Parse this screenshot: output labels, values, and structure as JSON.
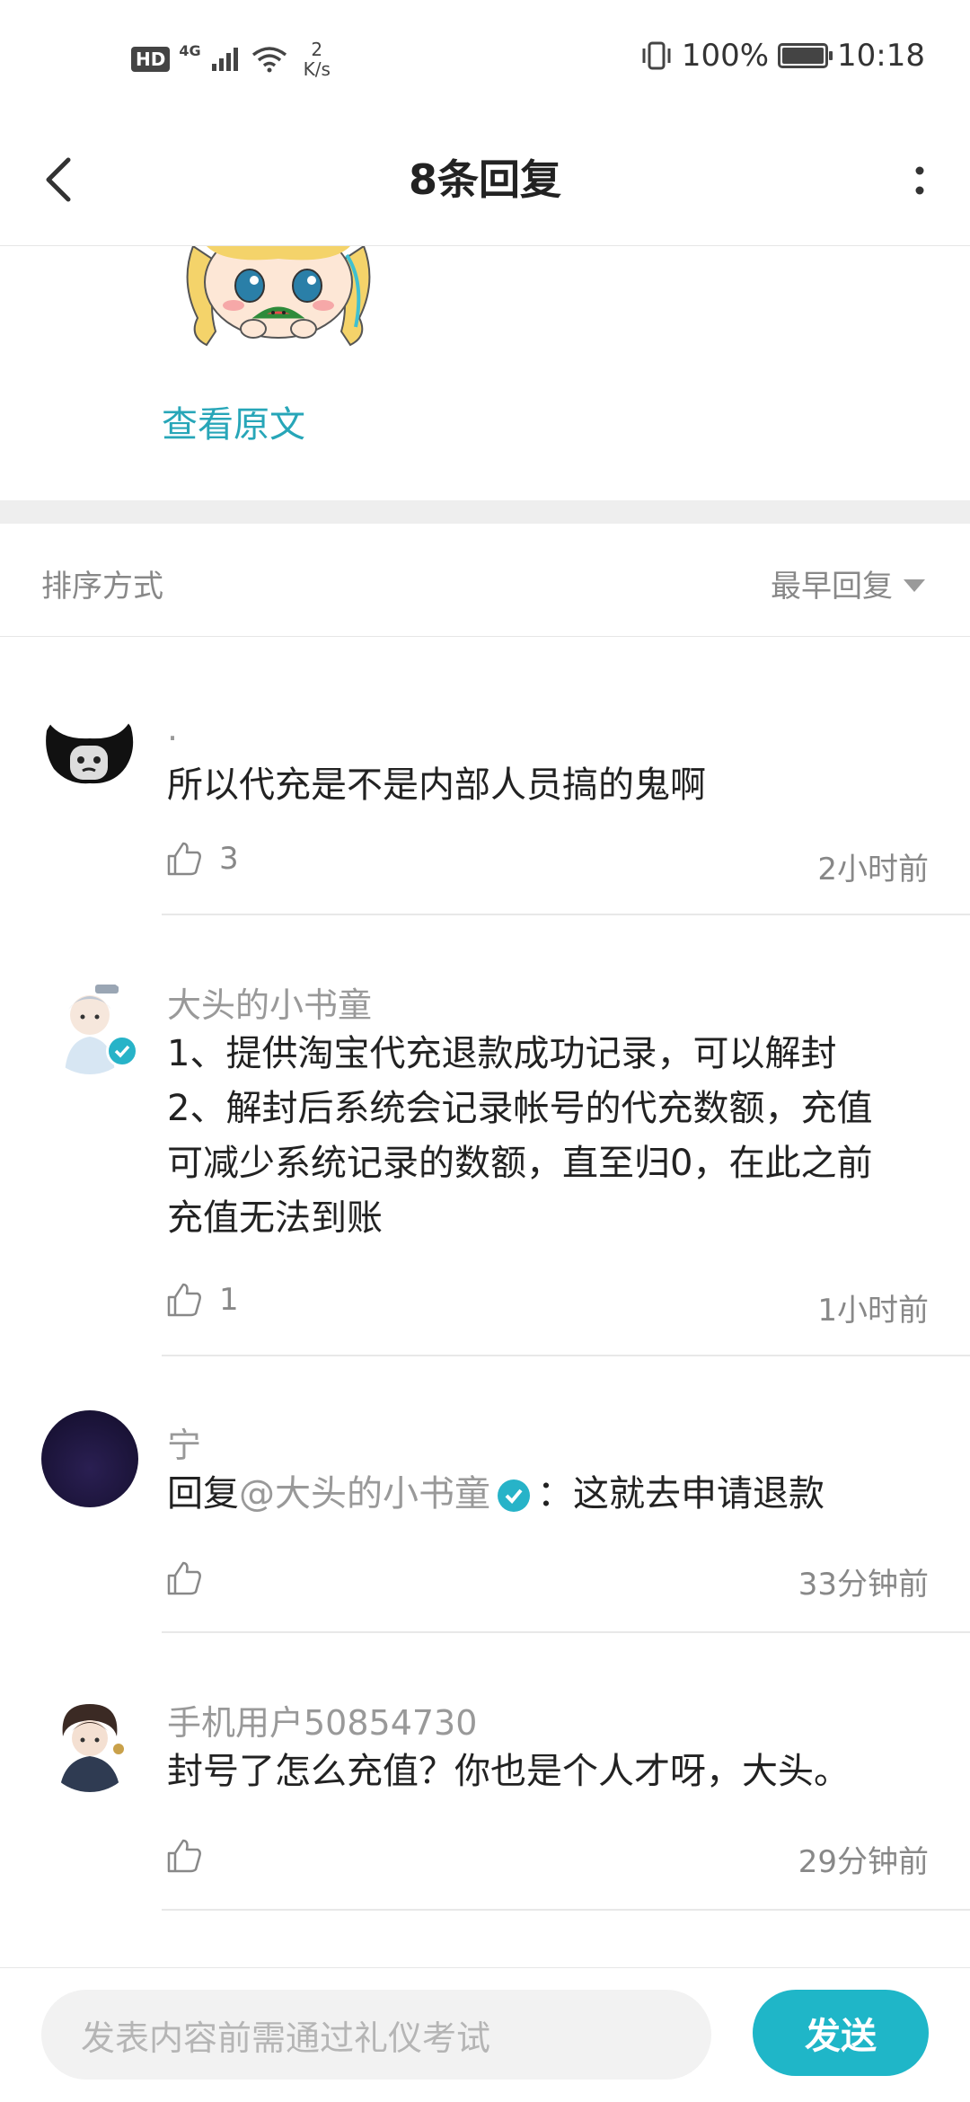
{
  "status_bar": {
    "hd": "HD",
    "network": "4G",
    "speed_value": "2",
    "speed_unit": "K/s",
    "battery": "100%",
    "time": "10:18"
  },
  "header": {
    "title": "8条回复"
  },
  "original": {
    "view_label": "查看原文"
  },
  "sort": {
    "label": "排序方式",
    "value": "最早回复"
  },
  "comments": [
    {
      "name": ".",
      "text": "所以代充是不是内部人员搞的鬼啊",
      "likes": "3",
      "time": "2小时前"
    },
    {
      "name": "大头的小书童",
      "text_lines": [
        "1、提供淘宝代充退款成功记录，可以解封",
        "2、解封后系统会记录帐号的代充数额，充值",
        "可减少系统记录的数额，直至归0，在此之前",
        "充值无法到账"
      ],
      "likes": "1",
      "time": "1小时前"
    },
    {
      "name": "宁",
      "reply_prefix": "回复",
      "mention": "@大头的小书童",
      "text": "：这就去申请退款",
      "time": "33分钟前"
    },
    {
      "name": "手机用户50854730",
      "text": "封号了怎么充值？你也是个人才呀，大头。",
      "time": "29分钟前"
    }
  ],
  "composer": {
    "placeholder": "发表内容前需通过礼仪考试",
    "send_label": "发送"
  },
  "colors": {
    "accent": "#1fb6c8",
    "link": "#27a6b8"
  }
}
